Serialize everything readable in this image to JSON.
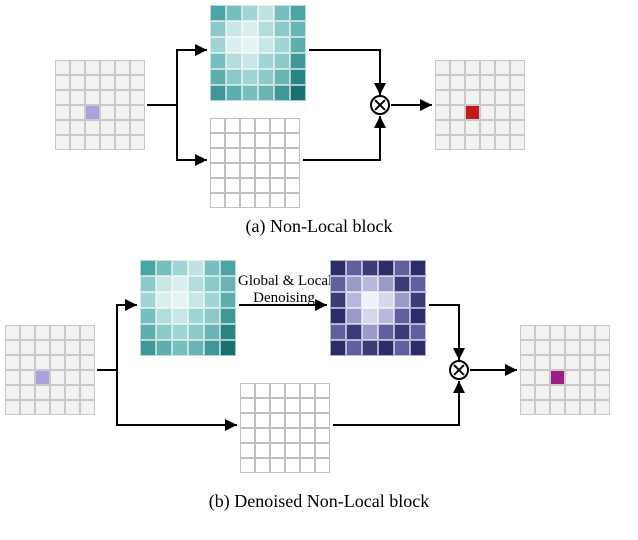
{
  "figure": {
    "panelA": {
      "caption": "(a) Non-Local block",
      "input": {
        "highlight": {
          "row": 3,
          "col": 2,
          "color": "#a7a3dc"
        }
      },
      "attention_colors": [
        [
          "#4ca5a5",
          "#76bfbf",
          "#a1d4d4",
          "#c2e2e2",
          "#76bfbf",
          "#4ca5a5"
        ],
        [
          "#8cc9c9",
          "#c8e6e6",
          "#d9eeee",
          "#b3dcdc",
          "#8cc9c9",
          "#6ab4b4"
        ],
        [
          "#a1d4d4",
          "#d9eeee",
          "#e6f3f3",
          "#c8e6e6",
          "#a1d4d4",
          "#5eaeae"
        ],
        [
          "#76bfbf",
          "#b3dcdc",
          "#c8e6e6",
          "#a1d4d4",
          "#8cc9c9",
          "#3f9797"
        ],
        [
          "#5eaeae",
          "#8cc9c9",
          "#a1d4d4",
          "#8cc9c9",
          "#6ab4b4",
          "#2a8383"
        ],
        [
          "#3f9797",
          "#5eaeae",
          "#76bfbf",
          "#6ab4b4",
          "#3f9797",
          "#1a7070"
        ]
      ],
      "output": {
        "highlight": {
          "row": 3,
          "col": 2,
          "color": "#c21919"
        }
      }
    },
    "panelB": {
      "caption": "(b) Denoised Non-Local block",
      "annotation": {
        "line1": "Global & Local",
        "line2": "Denoising"
      },
      "input": {
        "highlight": {
          "row": 3,
          "col": 2,
          "color": "#a7a3dc"
        }
      },
      "attention_colors": [
        [
          "#4ca5a5",
          "#76bfbf",
          "#a1d4d4",
          "#c2e2e2",
          "#76bfbf",
          "#4ca5a5"
        ],
        [
          "#8cc9c9",
          "#c8e6e6",
          "#d9eeee",
          "#b3dcdc",
          "#8cc9c9",
          "#6ab4b4"
        ],
        [
          "#a1d4d4",
          "#d9eeee",
          "#e6f3f3",
          "#c8e6e6",
          "#a1d4d4",
          "#5eaeae"
        ],
        [
          "#76bfbf",
          "#b3dcdc",
          "#c8e6e6",
          "#a1d4d4",
          "#8cc9c9",
          "#3f9797"
        ],
        [
          "#5eaeae",
          "#8cc9c9",
          "#a1d4d4",
          "#8cc9c9",
          "#6ab4b4",
          "#2a8383"
        ],
        [
          "#3f9797",
          "#5eaeae",
          "#76bfbf",
          "#6ab4b4",
          "#3f9797",
          "#1a7070"
        ]
      ],
      "denoised_colors": [
        [
          "#2c2c6b",
          "#6060a0",
          "#3b3b7a",
          "#2c2c6b",
          "#6060a0",
          "#2c2c6b"
        ],
        [
          "#6060a0",
          "#9a9ac9",
          "#b8b8de",
          "#9a9ac9",
          "#3b3b7a",
          "#6060a0"
        ],
        [
          "#3b3b7a",
          "#b8b8de",
          "#f0f0f8",
          "#d7d7ec",
          "#9a9ac9",
          "#3b3b7a"
        ],
        [
          "#2c2c6b",
          "#9a9ac9",
          "#d7d7ec",
          "#b8b8de",
          "#6060a0",
          "#2c2c6b"
        ],
        [
          "#6060a0",
          "#3b3b7a",
          "#9a9ac9",
          "#6060a0",
          "#3b3b7a",
          "#6060a0"
        ],
        [
          "#2c2c6b",
          "#6060a0",
          "#3b3b7a",
          "#2c2c6b",
          "#6060a0",
          "#2c2c6b"
        ]
      ],
      "output": {
        "highlight": {
          "row": 3,
          "col": 2,
          "color": "#9d1e86"
        }
      }
    }
  },
  "icons": {
    "otimes": "⊗"
  }
}
